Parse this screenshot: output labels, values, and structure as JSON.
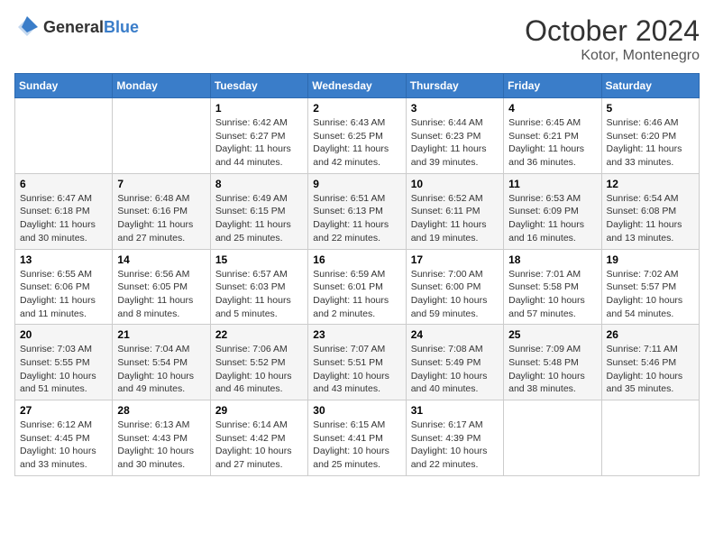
{
  "header": {
    "logo_general": "General",
    "logo_blue": "Blue",
    "month_title": "October 2024",
    "location": "Kotor, Montenegro"
  },
  "weekdays": [
    "Sunday",
    "Monday",
    "Tuesday",
    "Wednesday",
    "Thursday",
    "Friday",
    "Saturday"
  ],
  "weeks": [
    [
      {
        "day": null,
        "info": null
      },
      {
        "day": null,
        "info": null
      },
      {
        "day": "1",
        "info": "Sunrise: 6:42 AM\nSunset: 6:27 PM\nDaylight: 11 hours and 44 minutes."
      },
      {
        "day": "2",
        "info": "Sunrise: 6:43 AM\nSunset: 6:25 PM\nDaylight: 11 hours and 42 minutes."
      },
      {
        "day": "3",
        "info": "Sunrise: 6:44 AM\nSunset: 6:23 PM\nDaylight: 11 hours and 39 minutes."
      },
      {
        "day": "4",
        "info": "Sunrise: 6:45 AM\nSunset: 6:21 PM\nDaylight: 11 hours and 36 minutes."
      },
      {
        "day": "5",
        "info": "Sunrise: 6:46 AM\nSunset: 6:20 PM\nDaylight: 11 hours and 33 minutes."
      }
    ],
    [
      {
        "day": "6",
        "info": "Sunrise: 6:47 AM\nSunset: 6:18 PM\nDaylight: 11 hours and 30 minutes."
      },
      {
        "day": "7",
        "info": "Sunrise: 6:48 AM\nSunset: 6:16 PM\nDaylight: 11 hours and 27 minutes."
      },
      {
        "day": "8",
        "info": "Sunrise: 6:49 AM\nSunset: 6:15 PM\nDaylight: 11 hours and 25 minutes."
      },
      {
        "day": "9",
        "info": "Sunrise: 6:51 AM\nSunset: 6:13 PM\nDaylight: 11 hours and 22 minutes."
      },
      {
        "day": "10",
        "info": "Sunrise: 6:52 AM\nSunset: 6:11 PM\nDaylight: 11 hours and 19 minutes."
      },
      {
        "day": "11",
        "info": "Sunrise: 6:53 AM\nSunset: 6:09 PM\nDaylight: 11 hours and 16 minutes."
      },
      {
        "day": "12",
        "info": "Sunrise: 6:54 AM\nSunset: 6:08 PM\nDaylight: 11 hours and 13 minutes."
      }
    ],
    [
      {
        "day": "13",
        "info": "Sunrise: 6:55 AM\nSunset: 6:06 PM\nDaylight: 11 hours and 11 minutes."
      },
      {
        "day": "14",
        "info": "Sunrise: 6:56 AM\nSunset: 6:05 PM\nDaylight: 11 hours and 8 minutes."
      },
      {
        "day": "15",
        "info": "Sunrise: 6:57 AM\nSunset: 6:03 PM\nDaylight: 11 hours and 5 minutes."
      },
      {
        "day": "16",
        "info": "Sunrise: 6:59 AM\nSunset: 6:01 PM\nDaylight: 11 hours and 2 minutes."
      },
      {
        "day": "17",
        "info": "Sunrise: 7:00 AM\nSunset: 6:00 PM\nDaylight: 10 hours and 59 minutes."
      },
      {
        "day": "18",
        "info": "Sunrise: 7:01 AM\nSunset: 5:58 PM\nDaylight: 10 hours and 57 minutes."
      },
      {
        "day": "19",
        "info": "Sunrise: 7:02 AM\nSunset: 5:57 PM\nDaylight: 10 hours and 54 minutes."
      }
    ],
    [
      {
        "day": "20",
        "info": "Sunrise: 7:03 AM\nSunset: 5:55 PM\nDaylight: 10 hours and 51 minutes."
      },
      {
        "day": "21",
        "info": "Sunrise: 7:04 AM\nSunset: 5:54 PM\nDaylight: 10 hours and 49 minutes."
      },
      {
        "day": "22",
        "info": "Sunrise: 7:06 AM\nSunset: 5:52 PM\nDaylight: 10 hours and 46 minutes."
      },
      {
        "day": "23",
        "info": "Sunrise: 7:07 AM\nSunset: 5:51 PM\nDaylight: 10 hours and 43 minutes."
      },
      {
        "day": "24",
        "info": "Sunrise: 7:08 AM\nSunset: 5:49 PM\nDaylight: 10 hours and 40 minutes."
      },
      {
        "day": "25",
        "info": "Sunrise: 7:09 AM\nSunset: 5:48 PM\nDaylight: 10 hours and 38 minutes."
      },
      {
        "day": "26",
        "info": "Sunrise: 7:11 AM\nSunset: 5:46 PM\nDaylight: 10 hours and 35 minutes."
      }
    ],
    [
      {
        "day": "27",
        "info": "Sunrise: 6:12 AM\nSunset: 4:45 PM\nDaylight: 10 hours and 33 minutes."
      },
      {
        "day": "28",
        "info": "Sunrise: 6:13 AM\nSunset: 4:43 PM\nDaylight: 10 hours and 30 minutes."
      },
      {
        "day": "29",
        "info": "Sunrise: 6:14 AM\nSunset: 4:42 PM\nDaylight: 10 hours and 27 minutes."
      },
      {
        "day": "30",
        "info": "Sunrise: 6:15 AM\nSunset: 4:41 PM\nDaylight: 10 hours and 25 minutes."
      },
      {
        "day": "31",
        "info": "Sunrise: 6:17 AM\nSunset: 4:39 PM\nDaylight: 10 hours and 22 minutes."
      },
      {
        "day": null,
        "info": null
      },
      {
        "day": null,
        "info": null
      }
    ]
  ]
}
